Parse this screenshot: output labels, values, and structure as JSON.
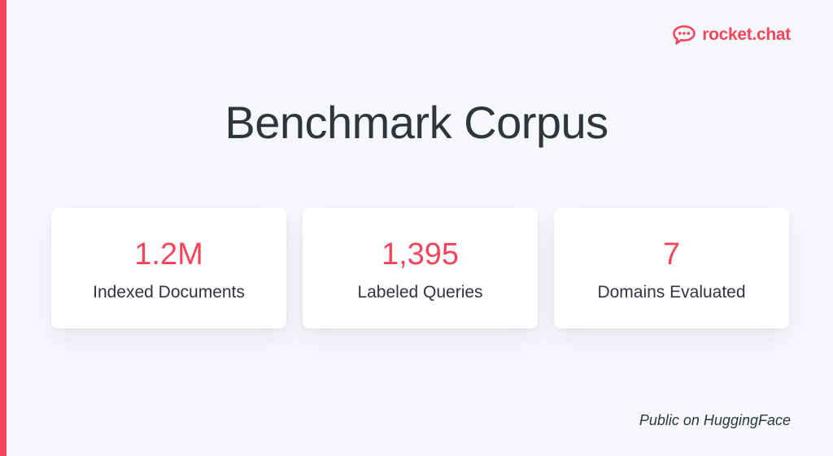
{
  "brand": {
    "name": "rocket.chat",
    "color": "#f5455c",
    "icon": "rocket-chat-logo-icon"
  },
  "title": "Benchmark Corpus",
  "stats": [
    {
      "value": "1.2M",
      "label": "Indexed Documents"
    },
    {
      "value": "1,395",
      "label": "Labeled Queries"
    },
    {
      "value": "7",
      "label": "Domains Evaluated"
    }
  ],
  "footnote": "Public on HuggingFace"
}
